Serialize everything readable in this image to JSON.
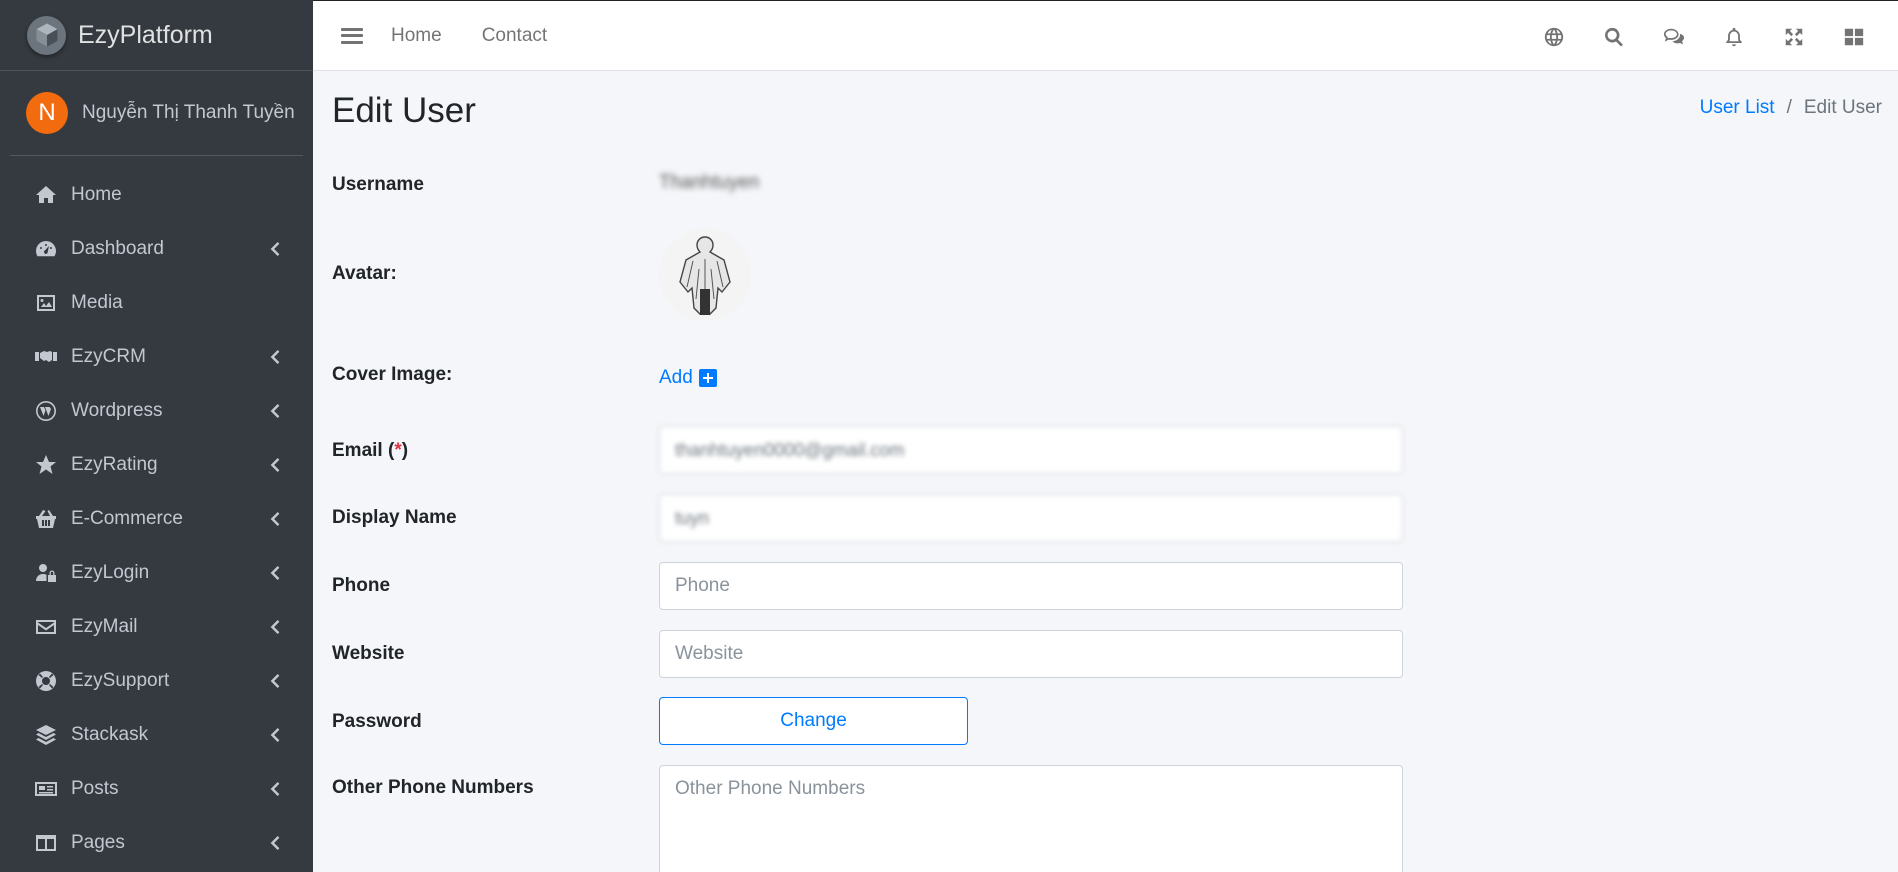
{
  "brand": {
    "name": "EzyPlatform"
  },
  "user": {
    "initial": "N",
    "name": "Nguyễn Thị Thanh Tuyền"
  },
  "sidebar": {
    "items": [
      {
        "label": "Home",
        "icon": "home-icon",
        "has_children": false
      },
      {
        "label": "Dashboard",
        "icon": "gauge-icon",
        "has_children": true
      },
      {
        "label": "Media",
        "icon": "image-icon",
        "has_children": false
      },
      {
        "label": "EzyCRM",
        "icon": "handshake-icon",
        "has_children": true
      },
      {
        "label": "Wordpress",
        "icon": "wordpress-icon",
        "has_children": true
      },
      {
        "label": "EzyRating",
        "icon": "star-icon",
        "has_children": true
      },
      {
        "label": "E-Commerce",
        "icon": "basket-icon",
        "has_children": true
      },
      {
        "label": "EzyLogin",
        "icon": "user-lock-icon",
        "has_children": true
      },
      {
        "label": "EzyMail",
        "icon": "envelope-icon",
        "has_children": true
      },
      {
        "label": "EzySupport",
        "icon": "lifebuoy-icon",
        "has_children": true
      },
      {
        "label": "Stackask",
        "icon": "layers-icon",
        "has_children": true
      },
      {
        "label": "Posts",
        "icon": "newspaper-icon",
        "has_children": true
      },
      {
        "label": "Pages",
        "icon": "columns-icon",
        "has_children": true
      }
    ]
  },
  "topbar": {
    "links": [
      "Home",
      "Contact"
    ],
    "icons": [
      "globe-icon",
      "search-icon",
      "comments-icon",
      "bell-icon",
      "expand-icon",
      "grid-icon"
    ]
  },
  "page": {
    "title": "Edit User",
    "breadcrumb": {
      "parent": "User List",
      "separator": "/",
      "current": "Edit User"
    }
  },
  "form": {
    "username": {
      "label": "Username",
      "value": "Thanhtuyen"
    },
    "avatar": {
      "label": "Avatar:"
    },
    "cover": {
      "label": "Cover Image:",
      "add_label": "Add"
    },
    "email": {
      "label_text": "Email (",
      "required_mark": "*",
      "label_end": ")",
      "value": "thanhtuyen0000@gmail.com"
    },
    "display_name": {
      "label": "Display Name",
      "value": "tuyn"
    },
    "phone": {
      "label": "Phone",
      "placeholder": "Phone"
    },
    "website": {
      "label": "Website",
      "placeholder": "Website"
    },
    "password": {
      "label": "Password",
      "button_label": "Change"
    },
    "other_phones": {
      "label": "Other Phone Numbers",
      "placeholder": "Other Phone Numbers"
    }
  },
  "colors": {
    "sidebar_bg": "#343a40",
    "accent": "#007bff",
    "avatar_bg": "#f26b0f",
    "required": "#dc3545"
  }
}
